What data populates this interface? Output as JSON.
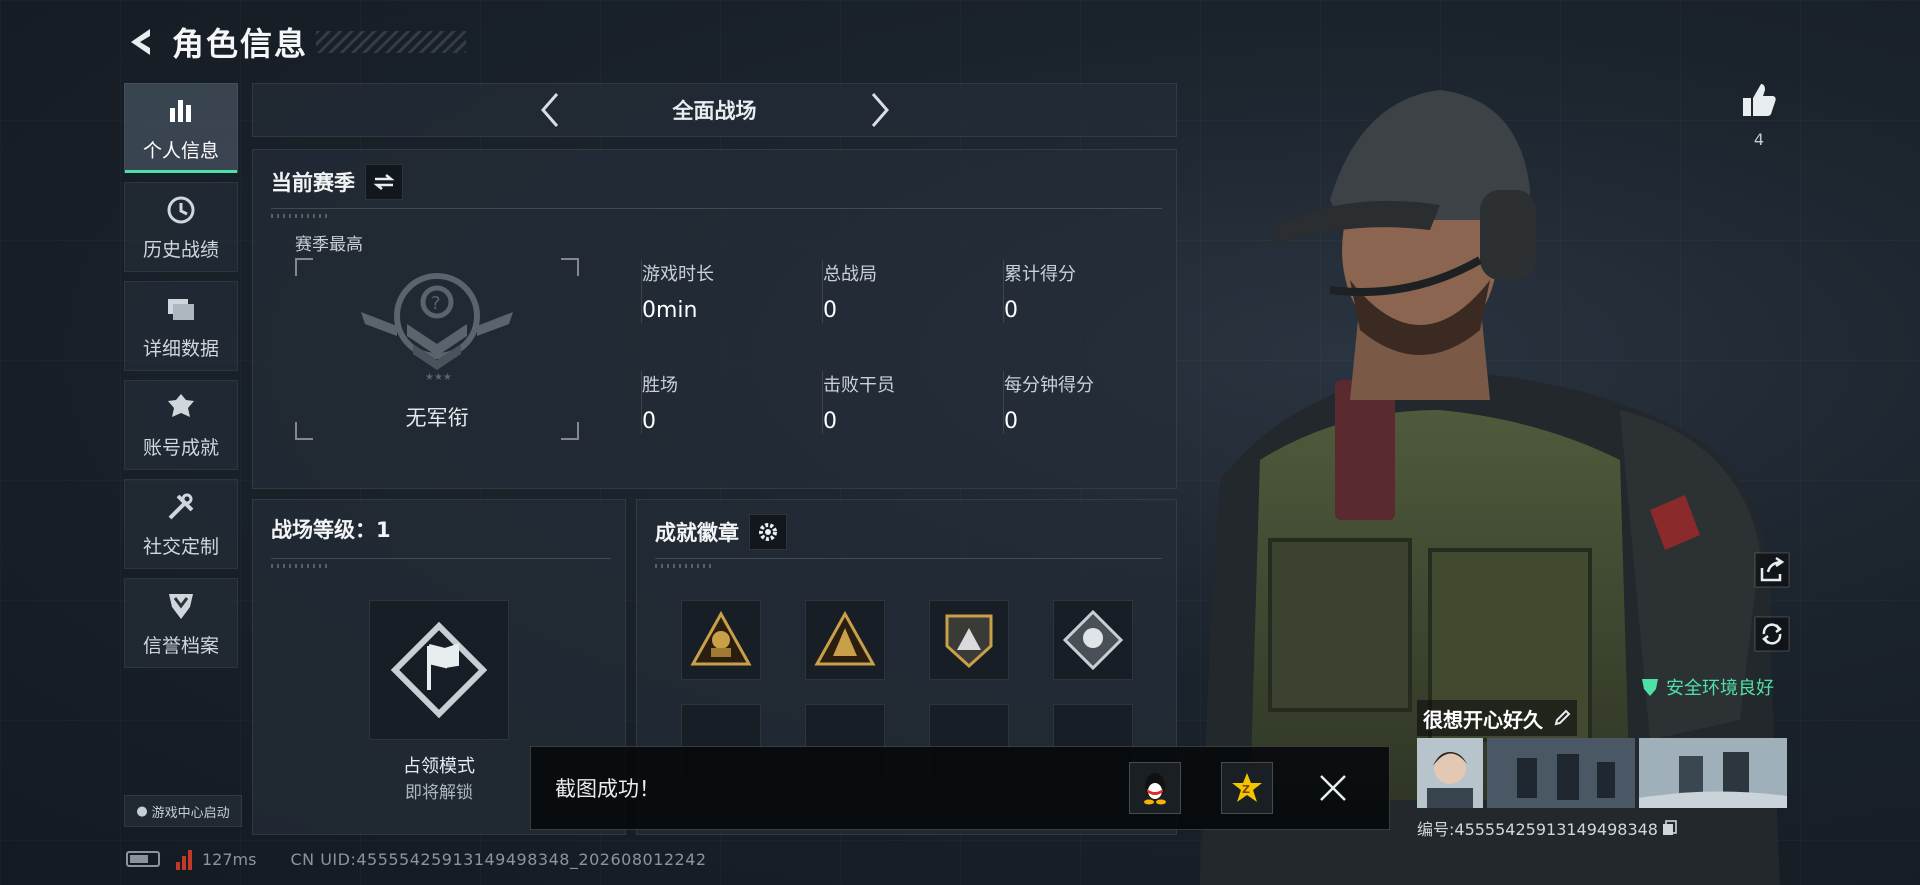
{
  "header": {
    "title": "角色信息"
  },
  "sidebar": {
    "items": [
      {
        "label": "个人信息",
        "icon": "stats-bars-icon",
        "active": true
      },
      {
        "label": "历史战绩",
        "icon": "history-icon",
        "active": false
      },
      {
        "label": "详细数据",
        "icon": "folders-icon",
        "active": false
      },
      {
        "label": "账号成就",
        "icon": "achievement-icon",
        "active": false
      },
      {
        "label": "社交定制",
        "icon": "tools-icon",
        "active": false
      },
      {
        "label": "信誉档案",
        "icon": "credit-shield-icon",
        "active": false
      }
    ],
    "game_center_label": "游戏中心启动"
  },
  "mode_bar": {
    "current_mode": "全面战场"
  },
  "season": {
    "title": "当前赛季",
    "best_label": "赛季最高",
    "rank_name": "无军衔",
    "stats": [
      {
        "label": "游戏时长",
        "value": "0min"
      },
      {
        "label": "总战局",
        "value": "0"
      },
      {
        "label": "累计得分",
        "value": "0"
      },
      {
        "label": "胜场",
        "value": "0"
      },
      {
        "label": "击败干员",
        "value": "0"
      },
      {
        "label": "每分钟得分",
        "value": "0"
      }
    ]
  },
  "battlefield_level": {
    "title": "战场等级：1",
    "mode_name": "占领模式",
    "mode_status": "即将解锁"
  },
  "badges": {
    "title": "成就徽章",
    "items": [
      "badge-bronze-soldier",
      "badge-bronze-triangle",
      "badge-silver-shield",
      "badge-silver-diamond",
      "badge-empty",
      "badge-empty",
      "badge-empty",
      "badge-empty"
    ]
  },
  "status_bar": {
    "ping": "127ms",
    "uid": "CN UID:45555425913149498348_202608012242"
  },
  "toast": {
    "message": "截图成功！"
  },
  "profile": {
    "like_count": "4",
    "safety_text": "安全环境良好",
    "nickname": "很想开心好久",
    "id_text": "编号:45555425913149498348"
  },
  "colors": {
    "accent": "#4ee0a8",
    "gold": "#c9a04a",
    "background": "#1a222b"
  }
}
